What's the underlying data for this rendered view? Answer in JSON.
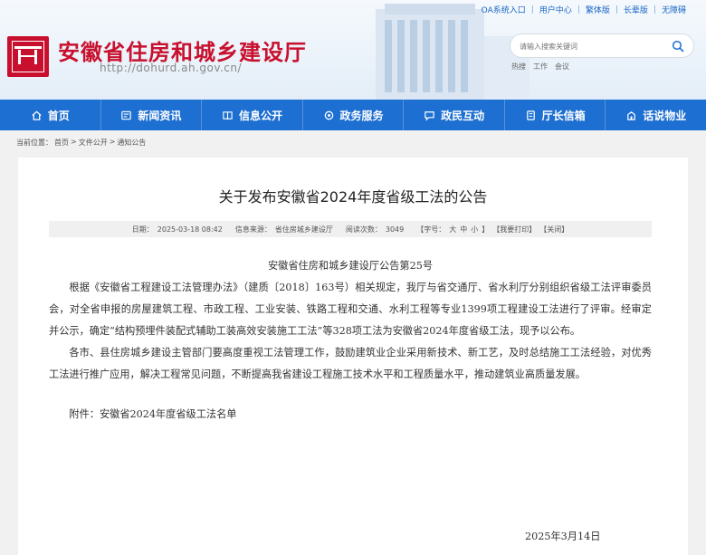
{
  "top_links": [
    "OA系统入口",
    "用户中心",
    "繁体版",
    "长辈版",
    "无障碍"
  ],
  "site": {
    "title": "安徽省住房和城乡建设厅",
    "url": "http://dohurd.ah.gov.cn/"
  },
  "search": {
    "placeholder": "请输入搜索关键词"
  },
  "hot": {
    "label": "热搜",
    "items": [
      "工作",
      "会议"
    ]
  },
  "nav": [
    {
      "label": "首页",
      "icon": "home-icon"
    },
    {
      "label": "新闻资讯",
      "icon": "news-icon"
    },
    {
      "label": "信息公开",
      "icon": "book-icon"
    },
    {
      "label": "政务服务",
      "icon": "service-icon"
    },
    {
      "label": "政民互动",
      "icon": "chat-icon"
    },
    {
      "label": "厅长信箱",
      "icon": "mail-icon"
    },
    {
      "label": "话说物业",
      "icon": "property-icon"
    }
  ],
  "breadcrumb": {
    "prefix": "当前位置：",
    "items": [
      "首页",
      "文件公开",
      "通知公告"
    ],
    "sep": ">"
  },
  "article": {
    "title": "关于发布安徽省2024年度省级工法的公告",
    "meta": {
      "date_label": "日期：",
      "date": "2025-03-18 08:42",
      "source_label": "信息来源：",
      "source": "省住房城乡建设厅",
      "views_label": "阅读次数：",
      "views": "3049",
      "font_label": "【字号：",
      "font_sizes": [
        "大",
        "中",
        "小"
      ],
      "font_close": "】",
      "print": "【我要打印】",
      "close": "【关闭】"
    },
    "notice_no": "安徽省住房和城乡建设厅公告第25号",
    "para1": "根据《安徽省工程建设工法管理办法》（建质〔2018〕163号）相关规定，我厅与省交通厅、省水利厅分别组织省级工法评审委员会，对全省申报的房屋建筑工程、市政工程、工业安装、铁路工程和交通、水利工程等专业1399项工程建设工法进行了评审。经审定并公示，确定“结构预埋件装配式辅助工装高效安装施工工法”等328项工法为安徽省2024年度省级工法，现予以公布。",
    "para2": "各市、县住房城乡建设主管部门要高度重视工法管理工作，鼓励建筑业企业采用新技术、新工艺，及时总结施工工法经验，对优秀工法进行推广应用，解决工程常见问题，不断提高我省建设工程施工技术水平和工程质量水平，推动建筑业高质量发展。",
    "attachment": "附件：安徽省2024年度省级工法名单",
    "sign_date": "2025年3月14日"
  },
  "colors": {
    "brand_red": "#c8102e",
    "nav_blue": "#1d6fd1",
    "link_blue": "#1a66c6"
  }
}
